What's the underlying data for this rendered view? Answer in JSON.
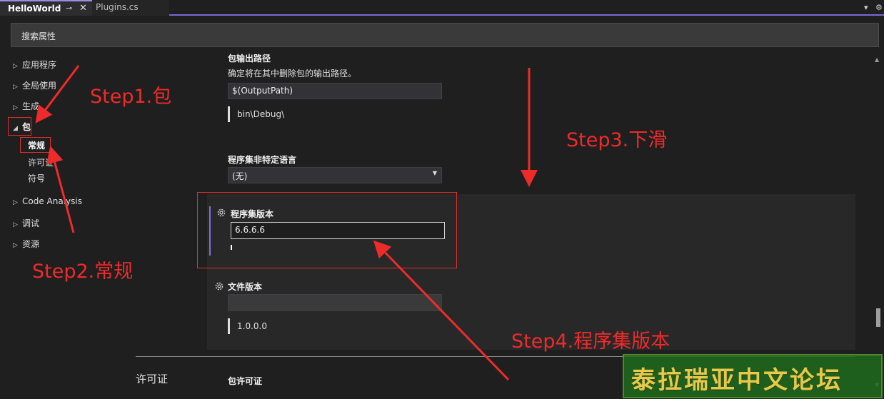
{
  "tabs": {
    "active": "HelloWorld",
    "pin": "⊸",
    "close": "✕",
    "inactive": "Plugins.cs",
    "dropdown": "▾",
    "settings": "⚙"
  },
  "search": {
    "placeholder": "搜索属性"
  },
  "sidebar": {
    "items": [
      "应用程序",
      "全局使用",
      "生成",
      "包",
      "Code Analysis",
      "调试",
      "资源"
    ],
    "sub_items": [
      "常规",
      "许可证",
      "符号"
    ]
  },
  "main": {
    "output_path": {
      "label": "包输出路径",
      "description": "确定将在其中删除包的输出路径。",
      "value": "$(OutputPath)",
      "preview": "bin\\Debug\\"
    },
    "neutral_language": {
      "label": "程序集非特定语言",
      "value": "(无)"
    },
    "assembly_version": {
      "label": "程序集版本",
      "value": "6.6.6.6"
    },
    "file_version": {
      "label": "文件版本",
      "value": "",
      "preview": "1.0.0.0"
    },
    "license_section": "许可证",
    "package_license": "包许可证"
  },
  "annotations": {
    "step1": "Step1.包",
    "step2": "Step2.常规",
    "step3": "Step3.下滑",
    "step4": "Step4.程序集版本",
    "color": "#ee2b2b"
  },
  "watermark": "泰拉瑞亚中文论坛",
  "colors": {
    "accent": "#8272d4",
    "background": "#1f1f1f"
  }
}
